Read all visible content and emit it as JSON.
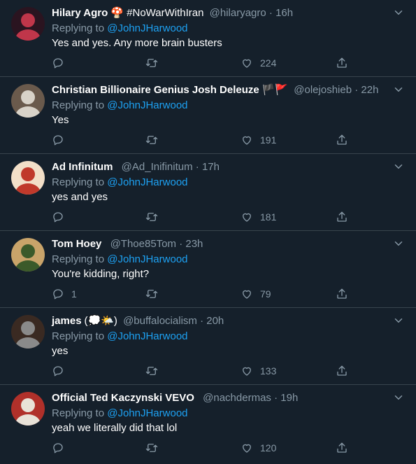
{
  "replying_label": "Replying to",
  "tweets": [
    {
      "name": "Hilary Agro",
      "name_extra": "🍄 #NoWarWithIran",
      "handle": "@hilaryagro",
      "dot": "·",
      "time": "16h",
      "mention": "@JohnJHarwood",
      "text": "Yes and yes. Any more brain busters",
      "reply_count": "",
      "like_count": "224",
      "avatar_colors": [
        "#c0364a",
        "#2a1420"
      ]
    },
    {
      "name": "Christian Billionaire Genius Josh Deleuze",
      "name_extra": "🏴🚩",
      "handle": "@olejoshieb",
      "dot": "·",
      "time": "22h",
      "mention": "@JohnJHarwood",
      "text": "Yes",
      "reply_count": "",
      "like_count": "191",
      "avatar_colors": [
        "#d8d2c8",
        "#6a5a4c"
      ]
    },
    {
      "name": "Ad Infinitum",
      "name_extra": "",
      "handle": "@Ad_Inifinitum",
      "dot": "·",
      "time": "17h",
      "mention": "@JohnJHarwood",
      "text": "yes and yes",
      "reply_count": "",
      "like_count": "181",
      "avatar_colors": [
        "#c0392b",
        "#f2dfc8"
      ]
    },
    {
      "name": "Tom Hoey",
      "name_extra": "",
      "handle": "@Thoe85Tom",
      "dot": "·",
      "time": "23h",
      "mention": "@JohnJHarwood",
      "text": "You're kidding, right?",
      "reply_count": "1",
      "like_count": "79",
      "avatar_colors": [
        "#3b5a2a",
        "#c9a46a"
      ]
    },
    {
      "name": "james",
      "name_extra": "(💭🌤️)",
      "handle": "@buffalocialism",
      "dot": "·",
      "time": "20h",
      "mention": "@JohnJHarwood",
      "text": "yes",
      "reply_count": "",
      "like_count": "133",
      "avatar_colors": [
        "#8a8a8a",
        "#3a2a22"
      ]
    },
    {
      "name": "Official Ted Kaczynski VEVO",
      "name_extra": "",
      "handle": "@nachdermas",
      "dot": "·",
      "time": "19h",
      "mention": "@JohnJHarwood",
      "text": "yeah we literally did that lol",
      "reply_count": "",
      "like_count": "120",
      "avatar_colors": [
        "#e8e2d8",
        "#b0302a"
      ]
    }
  ],
  "colors": {
    "background": "#15202b",
    "divider": "#38444d",
    "secondary_text": "#8899a6",
    "link": "#1da1f2"
  },
  "icons": [
    "reply-icon",
    "retweet-icon",
    "like-icon",
    "share-icon",
    "caret-down-icon"
  ]
}
